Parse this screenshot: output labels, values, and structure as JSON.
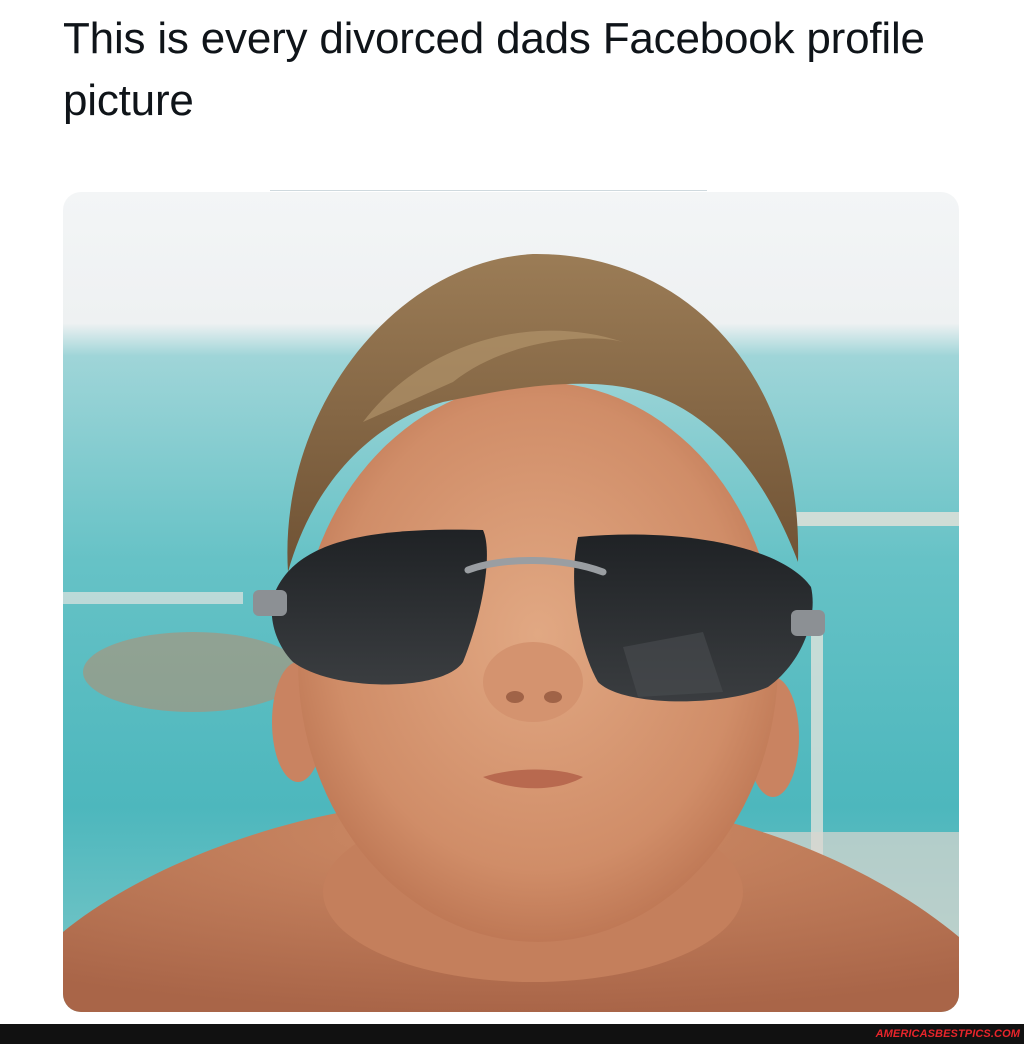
{
  "post": {
    "text": "This is every divorced dads Facebook profile picture"
  },
  "media": {
    "subject_icon": "photo-icon",
    "colors": {
      "sea": "#5fc6cc",
      "sky": "#e9eef0",
      "skin": "#d69a76",
      "hair": "#8a6a45",
      "lens": "#2a2d30"
    }
  },
  "footer": {
    "watermark": "AMERICASBESTPICS.COM"
  }
}
